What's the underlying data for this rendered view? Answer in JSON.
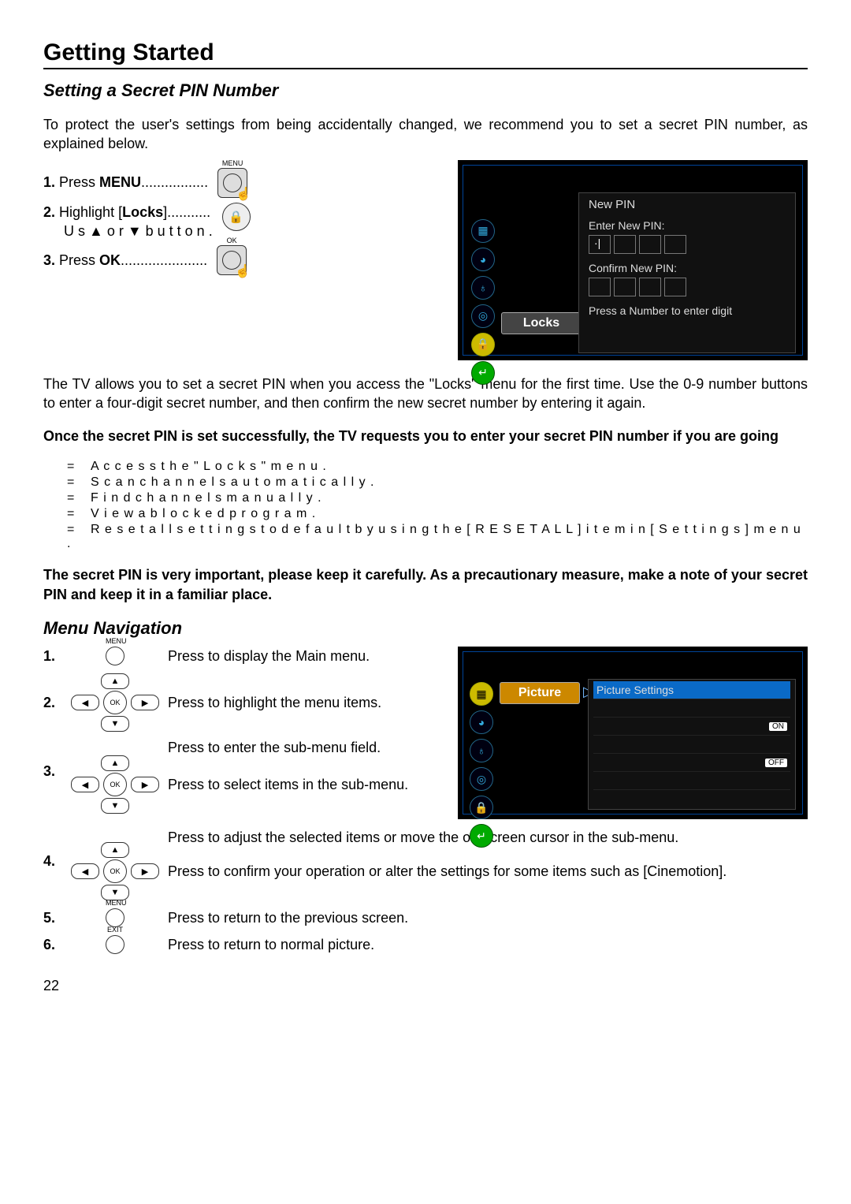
{
  "page": {
    "title": "Getting Started",
    "section1": "Setting a Secret PIN Number",
    "intro": "To protect the user's settings from being accidentally changed, we recommend you to set a secret PIN number, as explained below.",
    "step1": {
      "n": "1.",
      "t": "Press ",
      "b": "MENU",
      "dots": "................."
    },
    "step2": {
      "n": "2.",
      "t": "Highlight [",
      "b": "Locks",
      "t2": "]...........",
      "hint": "U s ▲ o r ▼  b u t t o n ."
    },
    "step3": {
      "n": "3.",
      "t": "Press ",
      "b": "OK",
      "dots": "......................"
    },
    "screen1": {
      "locks": "Locks",
      "newpin": "New PIN",
      "enter": "Enter New PIN:",
      "confirm": "Confirm New PIN:",
      "hint": "Press a Number to enter digit"
    },
    "body1": "The TV allows you to set a secret PIN when you access the \"Locks\" menu for the first time. Use the 0-9 number buttons to enter a four-digit secret number, and then confirm the new secret number by entering it again.",
    "note1": "Once the secret PIN is set successfully, the TV requests you to enter your secret PIN number if you are going",
    "bullets": [
      "A c c e s s  t h e  \" L o c k s \"  m e n u .",
      "S c a n  c h a n n e l s  a u t o m a t i c a l l y .",
      "F i n d  c h a n n e l s  m a n u a l l y .",
      "V i e w  a  b l o c k e d  p r o g r a m .",
      "R e s e t  a l l  s e t t i n g s  t o  d e f a u l t  b y  u s i n g  t h e  [ R E S E T  A L L ]  i t e m  i n  [ S e t t i n g s ]  m e n u ."
    ],
    "note2": "The secret PIN is very important, please keep it carefully. As a precautionary measure, make a note of your secret PIN and keep it in a familiar place.",
    "section2": "Menu Navigation",
    "nav": {
      "s1": "Press to display the Main menu.",
      "s2": "Press to highlight the menu items.",
      "s3a": "Press to enter the sub-menu field.",
      "s3b": "Press to select items in the sub-menu.",
      "s4a": "Press to adjust the selected items or move the on-screen cursor in the sub-menu.",
      "s4b": "Press to confirm your operation or alter the settings for some items such as [Cinemotion].",
      "s5": "Press to return to the previous screen.",
      "s6": "Press to return to normal picture."
    },
    "screen2": {
      "picture": "Picture",
      "subtitle": "Picture Settings",
      "on": "ON",
      "off": "OFF"
    },
    "menu_label": "MENU",
    "ok_label": "OK",
    "exit_label": "EXIT",
    "pagenum": "22"
  }
}
